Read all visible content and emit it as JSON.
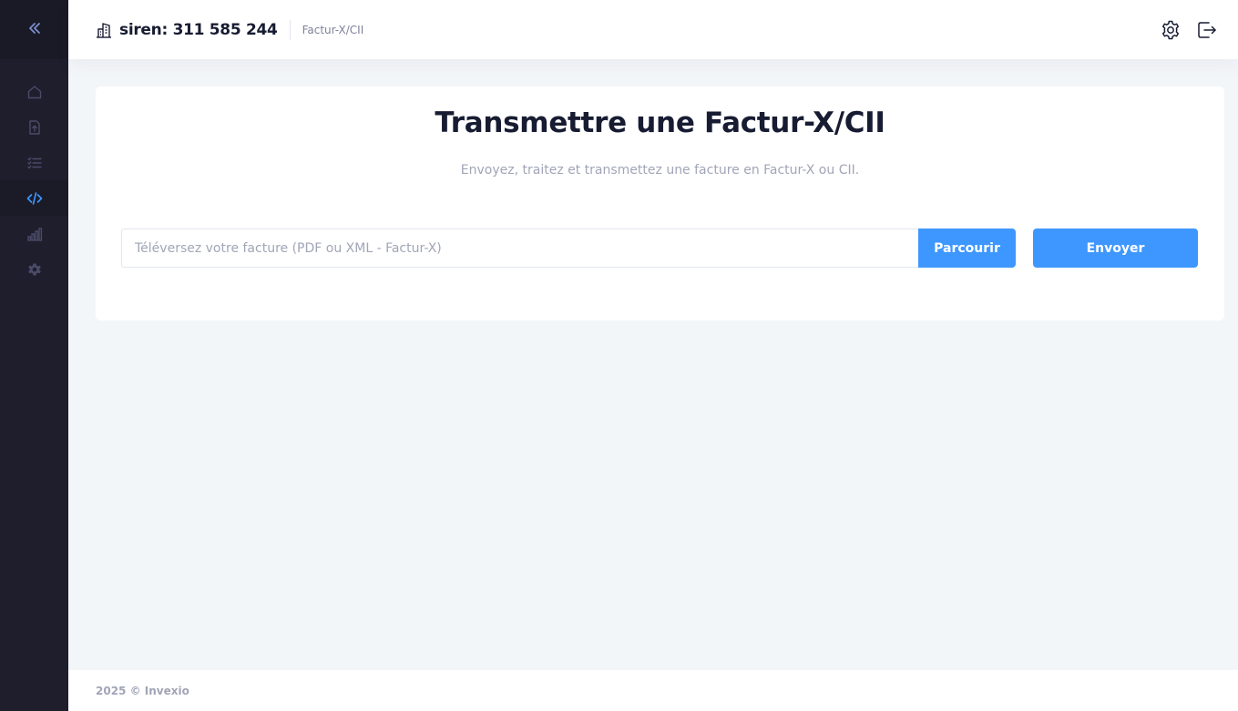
{
  "sidebar": {
    "toggle_icon": "double-chevron-left-icon",
    "items": [
      {
        "name": "home",
        "icon": "home-icon",
        "active": false
      },
      {
        "name": "upload",
        "icon": "file-upload-icon",
        "active": false
      },
      {
        "name": "list",
        "icon": "list-check-icon",
        "active": false
      },
      {
        "name": "code",
        "icon": "code-icon",
        "active": true
      },
      {
        "name": "stats",
        "icon": "bar-chart-icon",
        "active": false
      },
      {
        "name": "settings",
        "icon": "gear-icon",
        "active": false
      }
    ]
  },
  "header": {
    "company_icon": "building-icon",
    "company_label": "siren: 311 585 244",
    "breadcrumb": "Factur-X/CII",
    "actions": [
      {
        "name": "settings",
        "icon": "gear-outline-icon"
      },
      {
        "name": "logout",
        "icon": "logout-icon"
      }
    ]
  },
  "main": {
    "title": "Transmettre une Factur-X/CII",
    "subtitle": "Envoyez, traitez et transmettez une facture en Factur-X ou CII.",
    "upload": {
      "placeholder": "Téléversez votre facture (PDF ou XML - Factur-X)",
      "value": "",
      "browse_label": "Parcourir"
    },
    "send_label": "Envoyer"
  },
  "footer": {
    "text": "2025 © Invexio"
  },
  "colors": {
    "sidebar_bg": "#1e1e2d",
    "primary": "#3e97ff",
    "active_icon": "#3e97ff",
    "inactive_icon": "#4a4b68",
    "page_bg": "#f3f6f9"
  }
}
